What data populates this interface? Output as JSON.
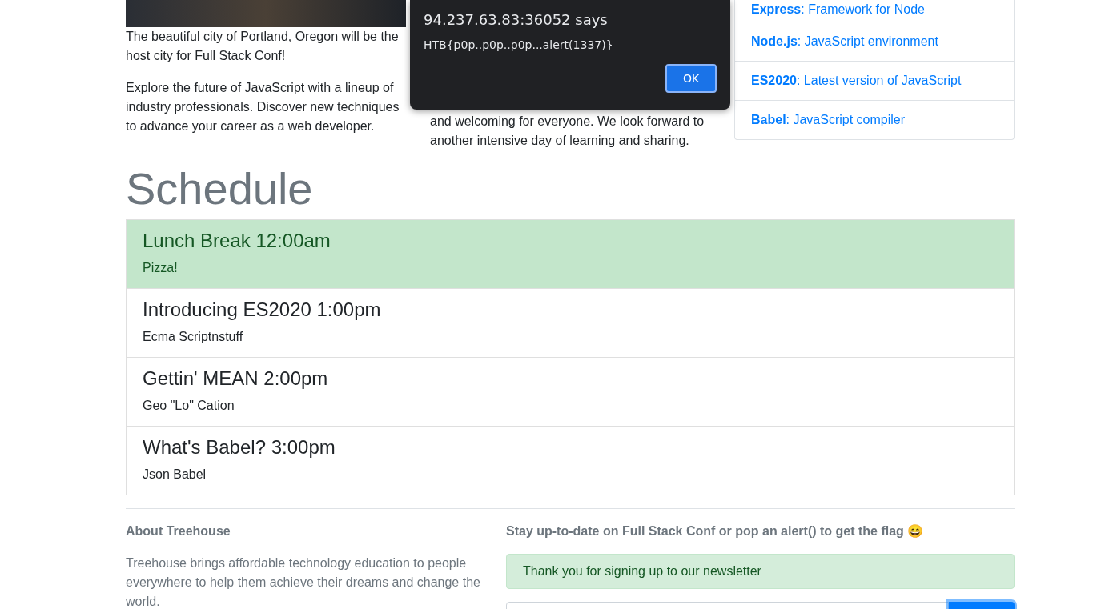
{
  "intro": {
    "paragraphs": [
      "The beautiful city of Portland, Oregon will be the host city for Full Stack Conf!",
      "Explore the future of JavaScript with a lineup of industry professionals. Discover new techniques to advance your career as a web developer."
    ],
    "middle_text": "and welcoming for everyone. We look forward to another intensive day of learning and sharing."
  },
  "topics": [
    {
      "name": "Express",
      "desc": ": Framework for Node"
    },
    {
      "name": "Node.js",
      "desc": ": JavaScript environment"
    },
    {
      "name": "ES2020",
      "desc": ": Latest version of JavaScript"
    },
    {
      "name": "Babel",
      "desc": ": JavaScript compiler"
    }
  ],
  "schedule": {
    "title": "Schedule",
    "items": [
      {
        "title": "Lunch Break 12:00am",
        "text": "Pizza!",
        "highlighted": true
      },
      {
        "title": "Introducing ES2020 1:00pm",
        "text": "Ecma Scriptnstuff",
        "highlighted": false
      },
      {
        "title": "Gettin' MEAN 2:00pm",
        "text": "Geo \"Lo\" Cation",
        "highlighted": false
      },
      {
        "title": "What's Babel? 3:00pm",
        "text": "Json Babel",
        "highlighted": false
      }
    ]
  },
  "about": {
    "title": "About Treehouse",
    "text": "Treehouse brings affordable technology education to people everywhere to help them achieve their dreams and change the world."
  },
  "newsletter": {
    "title": "Stay up-to-date on Full Stack Conf or pop an alert() to get the flag 😄",
    "alert": "Thank you for signing up to our newsletter"
  },
  "dialog": {
    "title": "94.237.63.83:36052 says",
    "message": "HTB{p0p..p0p..p0p...alert(1337)}",
    "button": "OK"
  }
}
